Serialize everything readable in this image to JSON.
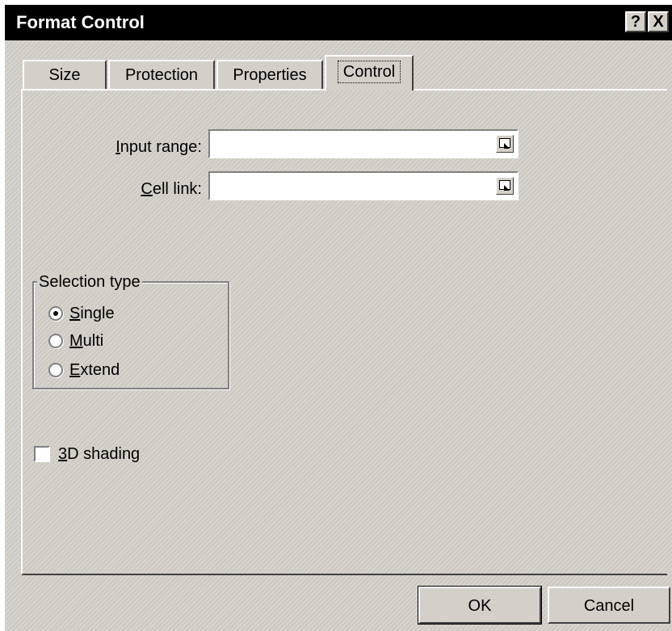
{
  "window": {
    "title": "Format Control",
    "help_glyph": "?",
    "close_glyph": "X"
  },
  "tabs": [
    {
      "label": "Size"
    },
    {
      "label": "Protection"
    },
    {
      "label": "Properties"
    },
    {
      "label": "Control",
      "active": true
    }
  ],
  "fields": {
    "input_range": {
      "label_pre": "",
      "label_accel": "I",
      "label_post": "nput range:",
      "value": ""
    },
    "cell_link": {
      "label_pre": "",
      "label_accel": "C",
      "label_post": "ell link:",
      "value": ""
    }
  },
  "selection_type": {
    "legend": "Selection type",
    "options": [
      {
        "accel": "S",
        "rest": "ingle",
        "checked": true
      },
      {
        "accel": "M",
        "rest": "ulti",
        "checked": false
      },
      {
        "accel": "E",
        "rest": "xtend",
        "checked": false
      }
    ]
  },
  "shading": {
    "accel": "3",
    "rest": "D shading",
    "checked": false
  },
  "buttons": {
    "ok": "OK",
    "cancel": "Cancel"
  },
  "colors": {
    "face": "#d4d0c8",
    "titlebar": "#000000",
    "field": "#ffffff"
  }
}
